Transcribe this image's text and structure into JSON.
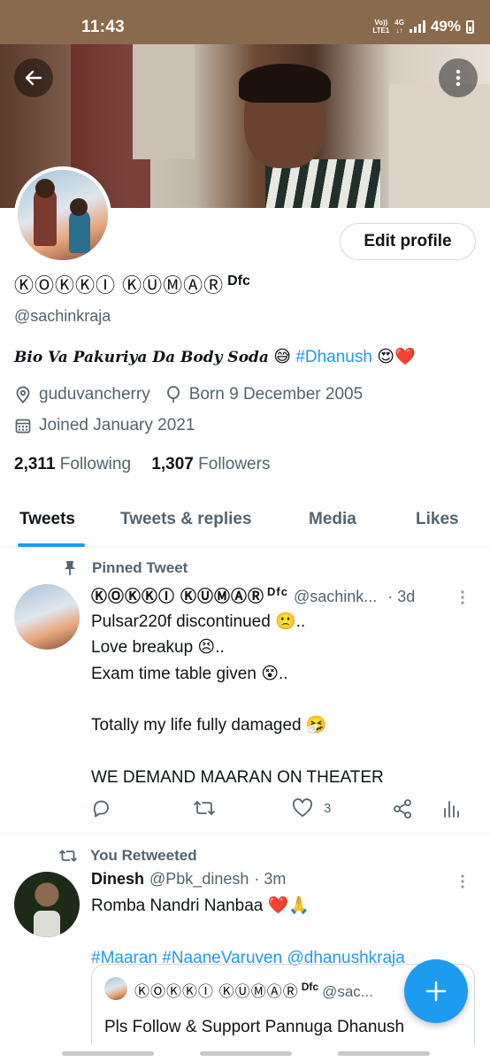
{
  "status_bar": {
    "time": "11:43",
    "network_top": "Vo))",
    "network_bottom": "LTE1",
    "data_top": "4G",
    "data_bottom": "↓↑",
    "battery": "49%"
  },
  "header": {
    "back_icon": "arrow-left-icon",
    "more_icon": "more-vertical-icon"
  },
  "profile": {
    "edit_label": "Edit profile",
    "name": "ⓀⓄⓀⓀⒾ ⓀⓊⓂⒶⓇ",
    "name_suffix": "Dfc",
    "handle": "@sachinkraja",
    "bio_text": "Bio Va Pakuriya Da Body Soda",
    "bio_emoji": "😅",
    "bio_tag": "#Dhanush",
    "bio_emoji2": "😍❤️",
    "location": "guduvancherry",
    "birthday": "Born 9 December 2005",
    "joined": "Joined January 2021",
    "following_count": "2,311",
    "following_label": "Following",
    "followers_count": "1,307",
    "followers_label": "Followers"
  },
  "tabs": [
    {
      "label": "Tweets",
      "active": true
    },
    {
      "label": "Tweets & replies",
      "active": false
    },
    {
      "label": "Media",
      "active": false
    },
    {
      "label": "Likes",
      "active": false
    }
  ],
  "tweets": [
    {
      "context": "Pinned Tweet",
      "context_icon": "pin-icon",
      "name": "ⓀⓄⓀⓀⒾ ⓀⓊⓂⒶⓇ",
      "name_suffix": "Dfc",
      "handle": "@sachink...",
      "time": "· 3d",
      "lines": [
        "Pulsar220f discontinued 🙁..",
        "Love breakup 😣..",
        "Exam time table given 😵..",
        "",
        "Totally my life fully damaged 🤧",
        "",
        "WE DEMAND MAARAN ON THEATER"
      ],
      "likes": "3"
    },
    {
      "context": "You Retweeted",
      "context_icon": "retweet-icon",
      "name": "Dinesh",
      "handle": "@Pbk_dinesh",
      "time": "· 3m",
      "line1": "Romba Nandri Nanbaa ❤️🙏",
      "tags": "#Maaran #NaaneVaruven @dhanushkraja",
      "quote": {
        "name": "ⓀⓄⓀⓀⒾ ⓀⓊⓂⒶⓇ",
        "name_suffix": "Dfc",
        "handle": "@sac...",
        "text": "Pls Follow & Support Pannuga Dhanush"
      }
    }
  ],
  "fab": {
    "icon": "plus-icon"
  },
  "colors": {
    "accent": "#1d9bf0",
    "secondary_text": "#536471",
    "status_bar": "#8a6a4c"
  }
}
